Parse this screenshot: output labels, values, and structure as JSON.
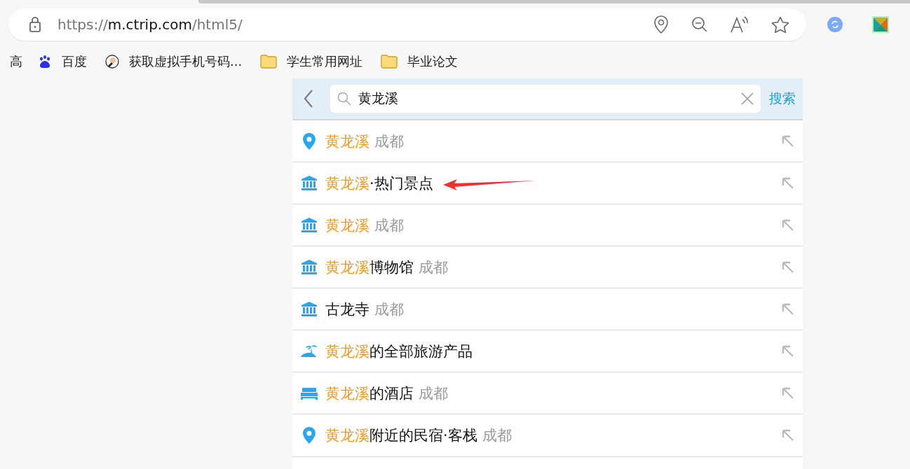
{
  "browser": {
    "url": {
      "scheme": "https://",
      "host": "m.ctrip.com",
      "path": "/html5/"
    }
  },
  "bookmarks": [
    {
      "kind": "cut",
      "label": "高"
    },
    {
      "kind": "paw",
      "label": "百度"
    },
    {
      "kind": "avatar",
      "label": "获取虚拟手机号码..."
    },
    {
      "kind": "folder",
      "label": "学生常用网址"
    },
    {
      "kind": "folder",
      "label": "毕业论文"
    }
  ],
  "search": {
    "value": "黄龙溪",
    "button": "搜索"
  },
  "suggestions": [
    {
      "kind": "pin",
      "match": "黄龙溪",
      "city": "成都"
    },
    {
      "kind": "museum",
      "match": "黄龙溪",
      "text": "·热门景点"
    },
    {
      "kind": "museum",
      "match": "黄龙溪",
      "city": "成都"
    },
    {
      "kind": "museum",
      "match": "黄龙溪",
      "text": "博物馆",
      "city": "成都"
    },
    {
      "kind": "museum",
      "text": "古龙寺",
      "city": "成都"
    },
    {
      "kind": "island",
      "match": "黄龙溪",
      "text": "的全部旅游产品"
    },
    {
      "kind": "bed",
      "match": "黄龙溪",
      "text": "的酒店",
      "city": "成都"
    },
    {
      "kind": "pin",
      "match": "黄龙溪",
      "text": "附近的民宿·客栈",
      "city": "成都"
    }
  ]
}
